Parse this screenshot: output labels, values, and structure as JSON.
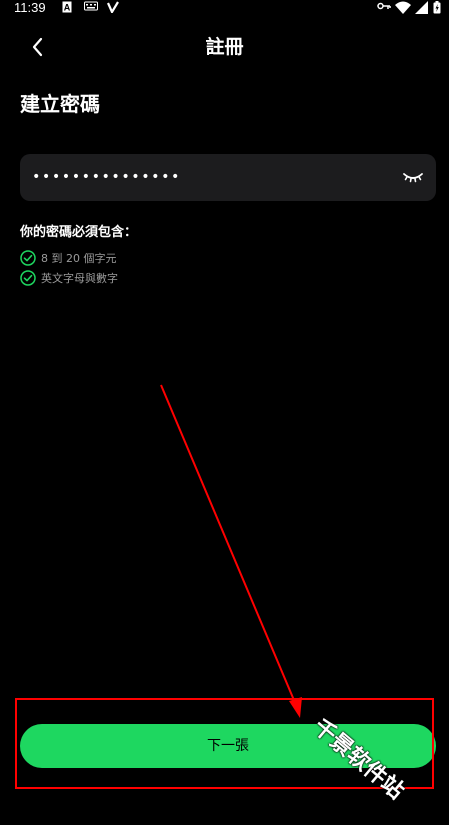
{
  "status_bar": {
    "time": "11:39"
  },
  "header": {
    "title": "註冊",
    "back_icon": "chevron-left-icon"
  },
  "page_title": "建立密碼",
  "password_field": {
    "value": "•••••••••••••••",
    "toggle_icon": "eye-closed-icon"
  },
  "requirements": {
    "heading": "你的密碼必須包含：",
    "items": [
      {
        "label": "8 到 20 個字元",
        "met": true
      },
      {
        "label": "英文字母與數字",
        "met": true
      }
    ]
  },
  "next_button": {
    "label": "下一張"
  },
  "watermark": "千景软件站",
  "colors": {
    "background": "#000000",
    "field_bg": "#1c1c1e",
    "accent": "#1ed760",
    "annotation": "#ff0000"
  }
}
